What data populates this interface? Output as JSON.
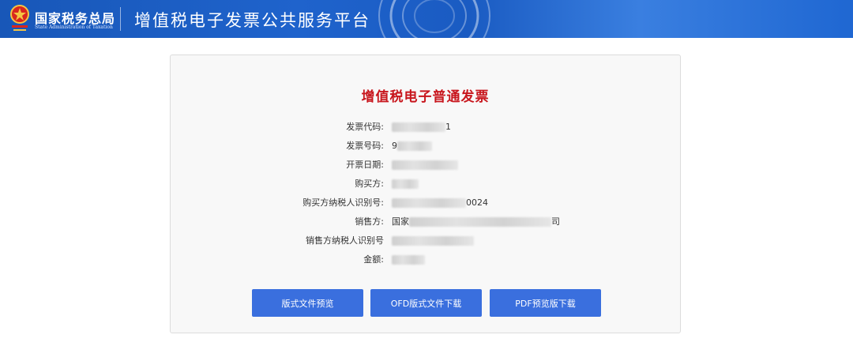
{
  "header": {
    "org_name_cn": "国家税务总局",
    "org_name_en": "State Administration of Taxation",
    "platform_title": "增值税电子发票公共服务平台"
  },
  "invoice": {
    "title": "增值税电子普通发票",
    "fields": [
      {
        "label": "发票代码:",
        "value_prefix": "",
        "value_suffix": "1"
      },
      {
        "label": "发票号码:",
        "value_prefix": "9",
        "value_suffix": ""
      },
      {
        "label": "开票日期:",
        "value_prefix": "",
        "value_suffix": ""
      },
      {
        "label": "购买方:",
        "value_prefix": "",
        "value_suffix": ""
      },
      {
        "label": "购买方纳税人识别号:",
        "value_prefix": "",
        "value_suffix": "0024"
      },
      {
        "label": "销售方:",
        "value_prefix": "国家",
        "value_suffix": "司"
      },
      {
        "label": "销售方纳税人识别号",
        "value_prefix": "",
        "value_suffix": ""
      },
      {
        "label": "金额:",
        "value_prefix": "",
        "value_suffix": ""
      }
    ]
  },
  "actions": {
    "layout_preview": "版式文件预览",
    "ofd_download": "OFD版式文件下载",
    "pdf_download": "PDF预览版下载"
  },
  "colors": {
    "header_blue": "#1f63cc",
    "title_red": "#c8161d",
    "button_blue": "#3a6fde"
  }
}
